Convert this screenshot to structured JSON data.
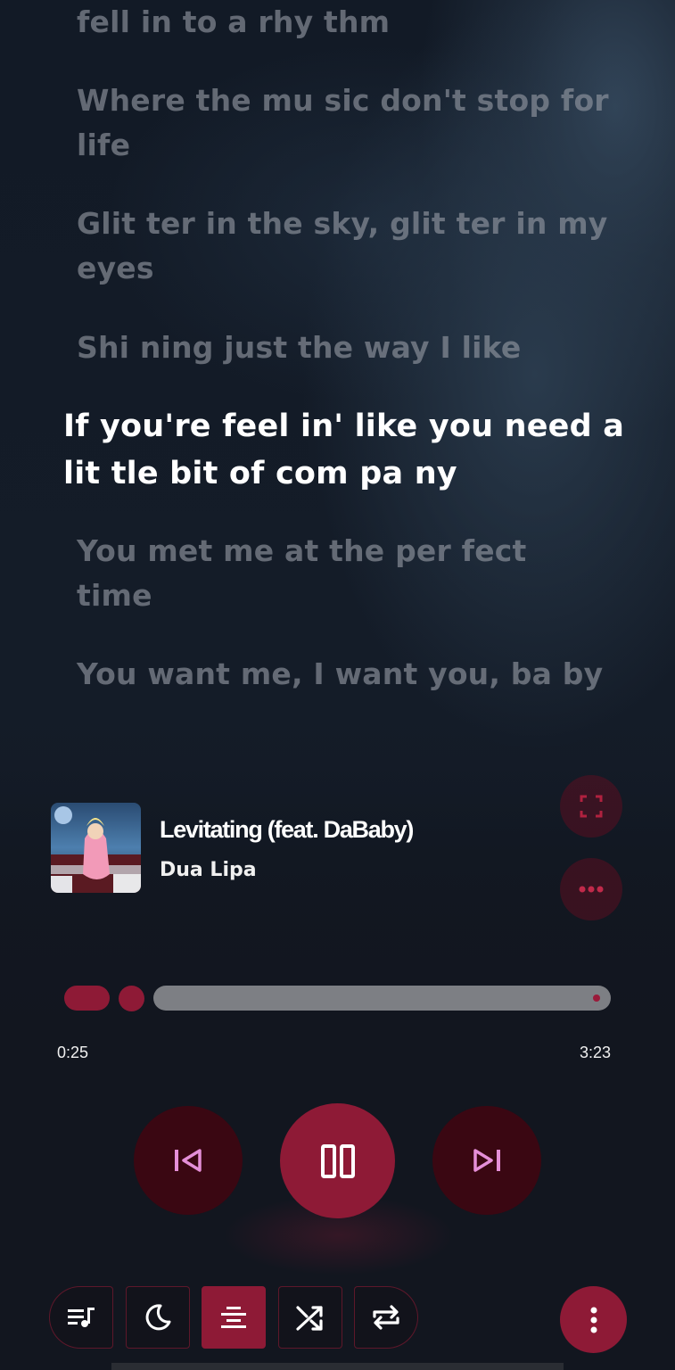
{
  "lyrics": [
    {
      "text": "fell in to a rhy thm",
      "state": "dim"
    },
    {
      "text": "Where the mu sic don't stop for life",
      "state": "dim"
    },
    {
      "text": "Glit ter in the sky, glit ter in my eyes",
      "state": "dim"
    },
    {
      "text": "Shi ning just the way I like",
      "state": "dim"
    },
    {
      "text": "If you're feel in' like you need a lit tle bit of com pa ny",
      "state": "active"
    },
    {
      "text": "You met me at the per fect time",
      "state": "dim"
    },
    {
      "text": "You want me, I want you, ba by",
      "state": "dim"
    }
  ],
  "track": {
    "title": "Levitating (feat. DaBaby)",
    "artist": "Dua Lipa",
    "album_art_icon": "album-cover"
  },
  "actions": {
    "fullscreen_icon": "fullscreen-icon",
    "more_icon": "more-horizontal-icon"
  },
  "progress": {
    "elapsed": "0:25",
    "total": "3:23",
    "fraction": 0.12
  },
  "controls": {
    "previous_icon": "skip-previous-icon",
    "play_pause_icon": "pause-icon",
    "next_icon": "skip-next-icon"
  },
  "toolbar": {
    "items": [
      {
        "icon": "queue-music-icon",
        "active": false
      },
      {
        "icon": "sleep-timer-moon-icon",
        "active": false
      },
      {
        "icon": "lyrics-icon",
        "active": true
      },
      {
        "icon": "shuffle-icon",
        "active": false
      },
      {
        "icon": "repeat-icon",
        "active": false
      }
    ],
    "menu_icon": "more-vertical-icon"
  },
  "colors": {
    "accent": "#8e1a36",
    "accent_dark": "#3a0712",
    "icon_pink": "#e58fd8",
    "background": "#12161f"
  }
}
